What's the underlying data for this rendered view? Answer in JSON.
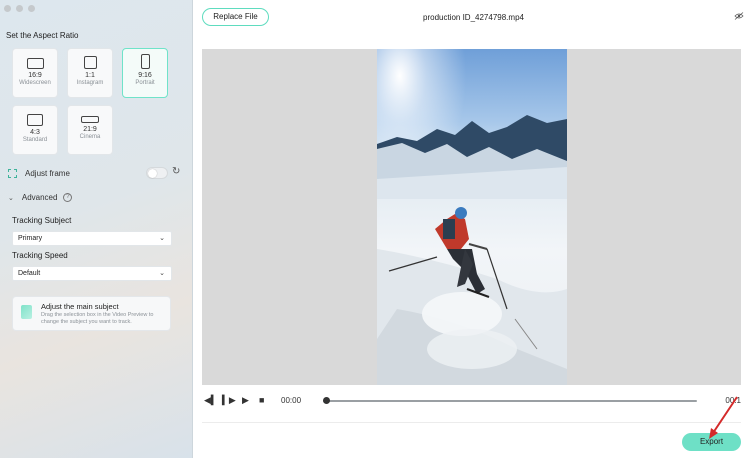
{
  "sidebar": {
    "section_title": "Set the Aspect Ratio",
    "ratios": [
      {
        "num": "16:9",
        "name": "Widescreen"
      },
      {
        "num": "1:1",
        "name": "Instagram"
      },
      {
        "num": "9:16",
        "name": "Portrait"
      },
      {
        "num": "4:3",
        "name": "Standard"
      },
      {
        "num": "21:9",
        "name": "Cinema"
      }
    ],
    "selected_ratio": "9:16",
    "adjust_frame_label": "Adjust frame",
    "advanced_label": "Advanced",
    "tracking_subject_label": "Tracking Subject",
    "tracking_subject_value": "Primary",
    "tracking_speed_label": "Tracking Speed",
    "tracking_speed_value": "Default",
    "hint_title": "Adjust the main subject",
    "hint_desc": "Drag the selection box in the Video Preview to change the subject you want to track."
  },
  "main": {
    "replace_label": "Replace File",
    "file_name": "production ID_4274798.mp4",
    "time_start": "00:00",
    "time_end": "00:1",
    "export_label": "Export"
  },
  "colors": {
    "accent": "#6ee0c6",
    "preview_bg": "#d9d9d9"
  }
}
